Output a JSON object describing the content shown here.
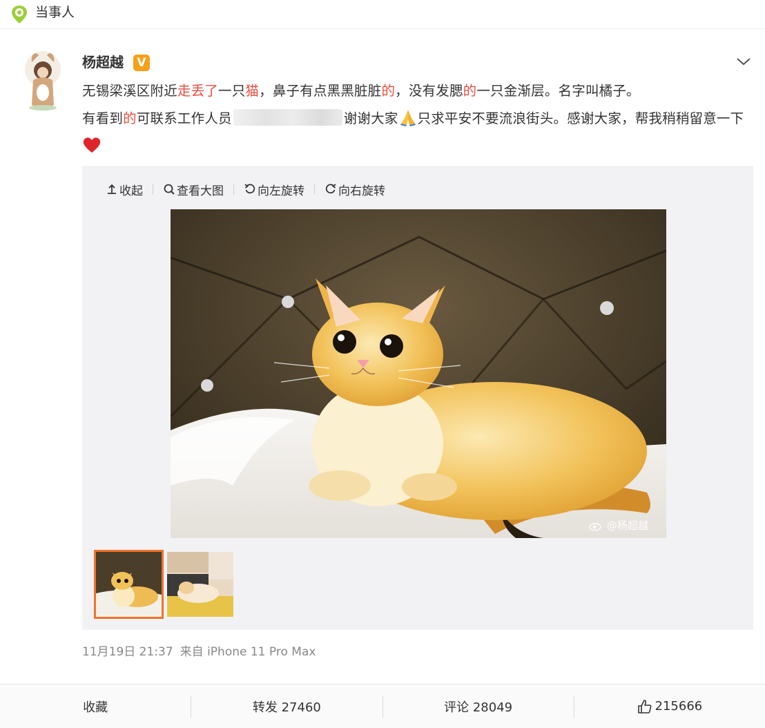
{
  "header": {
    "title": "当事人"
  },
  "post": {
    "username": "杨超越",
    "verified_badge": "V",
    "text": {
      "p1": "无锡梁溪区附近",
      "p1_hl1": "走丢了",
      "p2": "一只",
      "p2_hl": "猫",
      "p3": "，鼻子有点黑黑脏脏",
      "p3_hl": "的",
      "p4": "，没有发腮",
      "p4_hl": "的",
      "p5": "一只金渐层。名字叫橘子。",
      "p6": "有看到",
      "p6_hl": "的",
      "p7": "可联系工作人员",
      "p8": "谢谢大家",
      "p9": "只求平安不要流浪街头。感谢大家，帮我稍稍留意一下"
    },
    "toolbar": {
      "collapse": "收起",
      "view_large": "查看大图",
      "rotate_left": "向左旋转",
      "rotate_right": "向右旋转"
    },
    "watermark": "@杨超越",
    "meta": {
      "time": "11月19日 21:37",
      "source": "来自 iPhone 11 Pro Max"
    }
  },
  "actions": {
    "favorite": "收藏",
    "repost": "转发 27460",
    "comment": "评论 28049",
    "like": "215666"
  },
  "colors": {
    "highlight": "#eb4b3c",
    "badge": "#f6a11a",
    "thumb_border": "#f0732b"
  }
}
